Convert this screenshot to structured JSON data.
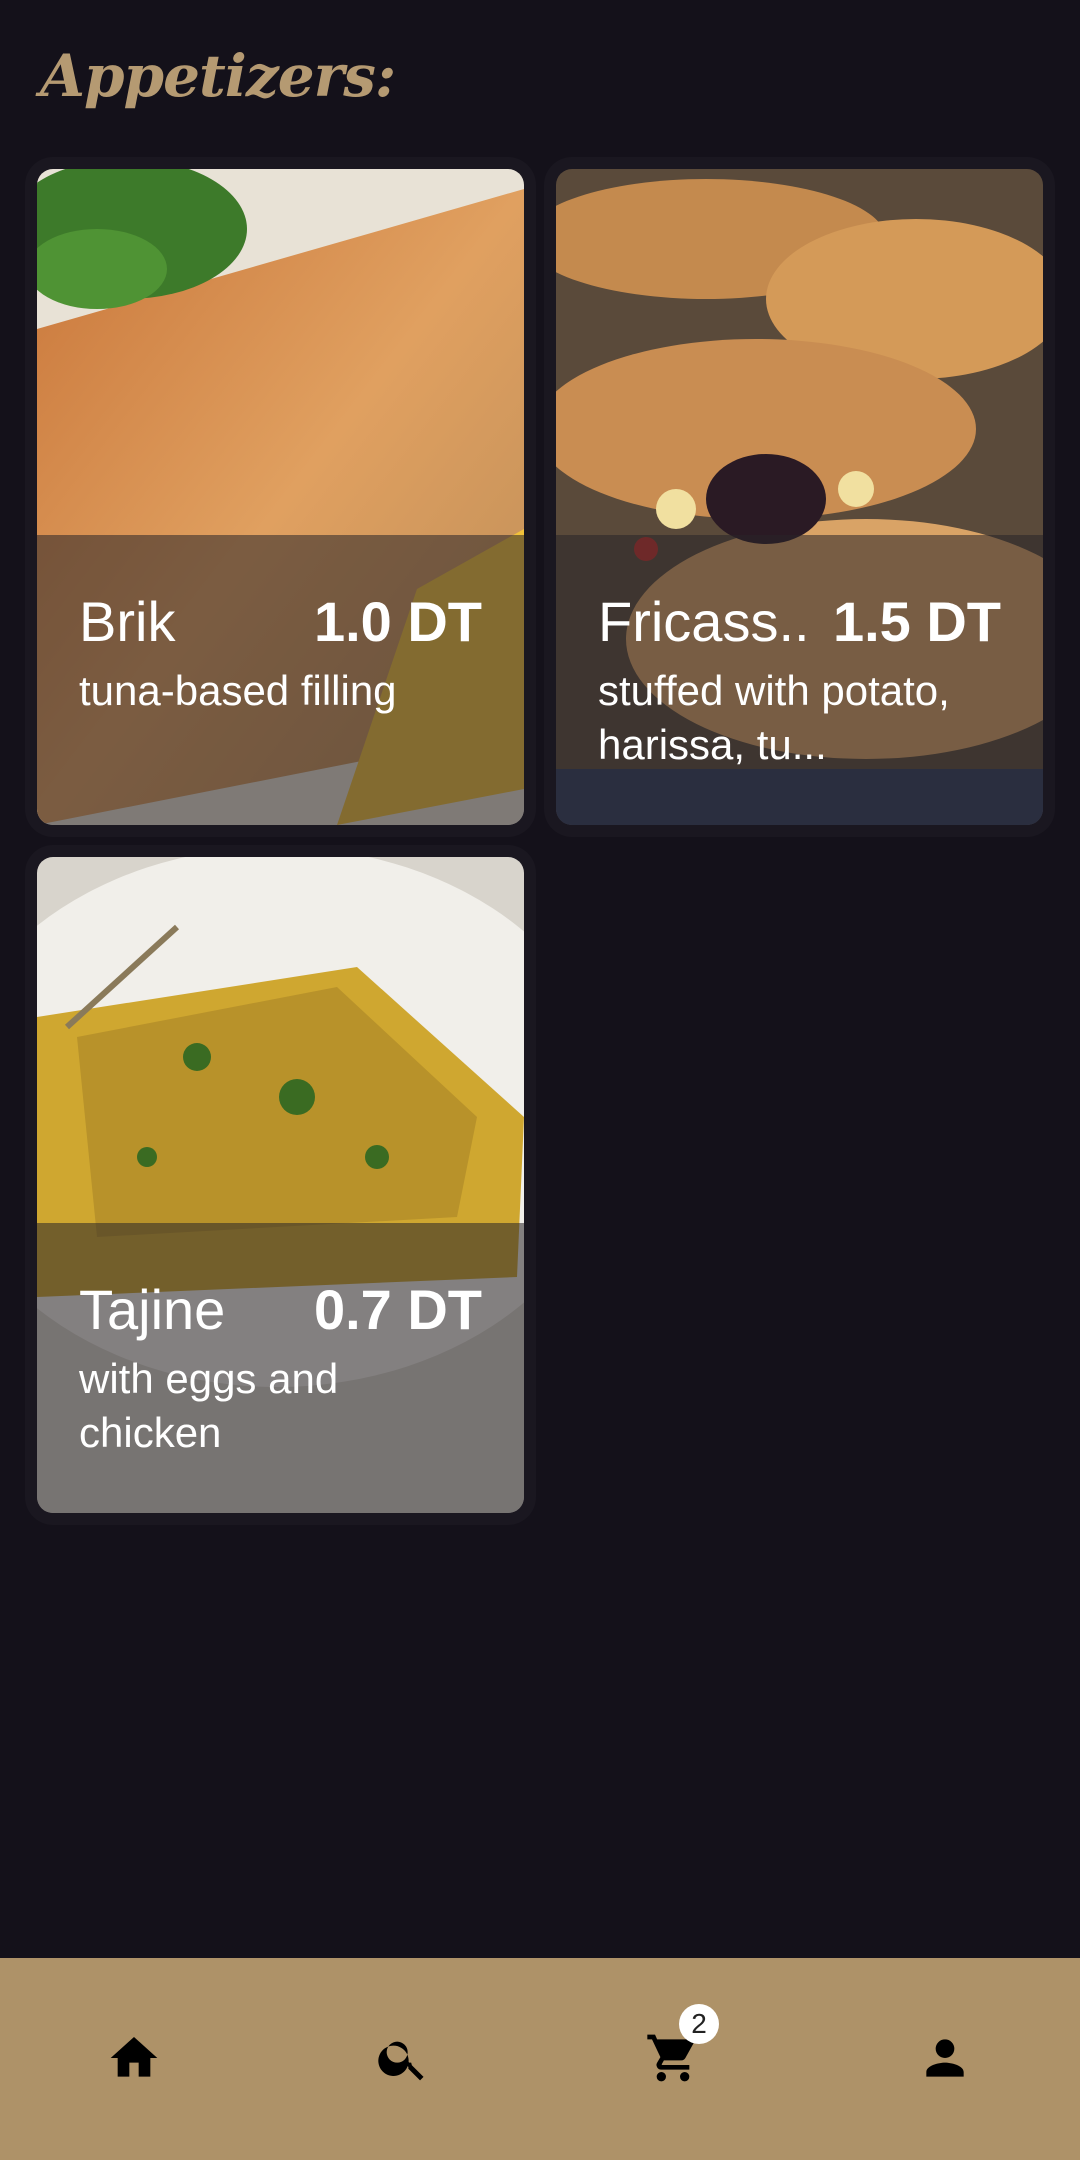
{
  "section": {
    "title": "Appetizers:"
  },
  "dishes": [
    {
      "name": "Brik",
      "price": "1.0 DT",
      "description": "tuna-based filling"
    },
    {
      "name": "Fricass..",
      "price": "1.5 DT",
      "description": "stuffed with potato, harissa, tu..."
    },
    {
      "name": "Tajine",
      "price": "0.7 DT",
      "description": "with eggs and chicken"
    }
  ],
  "bottom_nav": {
    "items": [
      {
        "icon": "home-icon"
      },
      {
        "icon": "search-icon"
      },
      {
        "icon": "cart-icon",
        "badge": "2"
      },
      {
        "icon": "profile-icon"
      }
    ]
  },
  "colors": {
    "background": "#14111a",
    "accent": "#ae9268",
    "title": "#b59a72"
  }
}
